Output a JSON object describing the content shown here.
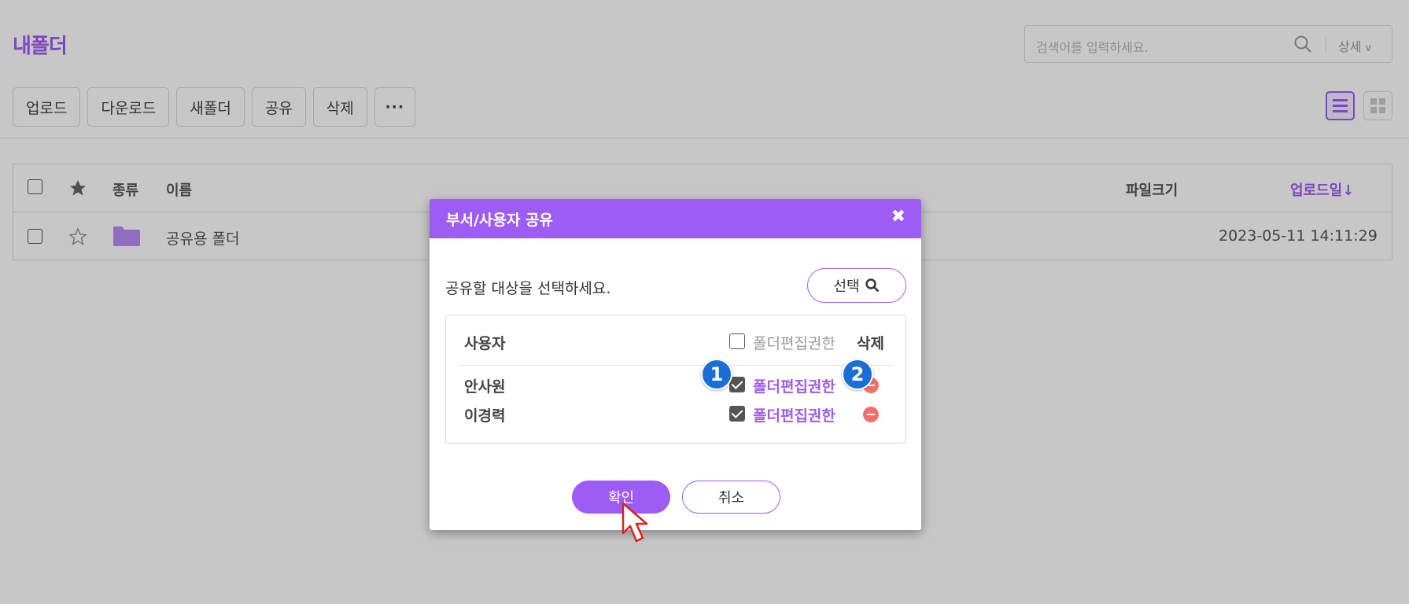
{
  "page": {
    "title": "내폴더",
    "search": {
      "placeholder": "검색어를 입력하세요.",
      "detail_label": "상세"
    },
    "toolbar": {
      "upload": "업로드",
      "download": "다운로드",
      "new_folder": "새폴더",
      "share": "공유",
      "delete": "삭제",
      "more": "···"
    },
    "table": {
      "headers": {
        "type": "종류",
        "name": "이름",
        "size": "파일크기",
        "upload_date": "업로드일↓"
      },
      "rows": [
        {
          "name": "공유용 폴더",
          "size": "",
          "upload_date": "2023-05-11 14:11:29"
        }
      ]
    }
  },
  "modal": {
    "title": "부서/사용자 공유",
    "close_icon": "close-icon",
    "prompt": "공유할 대상을 선택하세요.",
    "select_label": "선택",
    "share_table": {
      "user_header": "사용자",
      "perm_header": "폴더편집권한",
      "delete_header": "삭제",
      "users": [
        {
          "name": "안사원",
          "perm_label": "폴더편집권한",
          "checked": true
        },
        {
          "name": "이경력",
          "perm_label": "폴더편집권한",
          "checked": true
        }
      ]
    },
    "ok_label": "확인",
    "cancel_label": "취소"
  },
  "annotations": {
    "badge1": "1",
    "badge2": "2"
  },
  "colors": {
    "accent": "#9d5cf3",
    "badge": "#1a6fd6",
    "delete": "#f2706a"
  }
}
